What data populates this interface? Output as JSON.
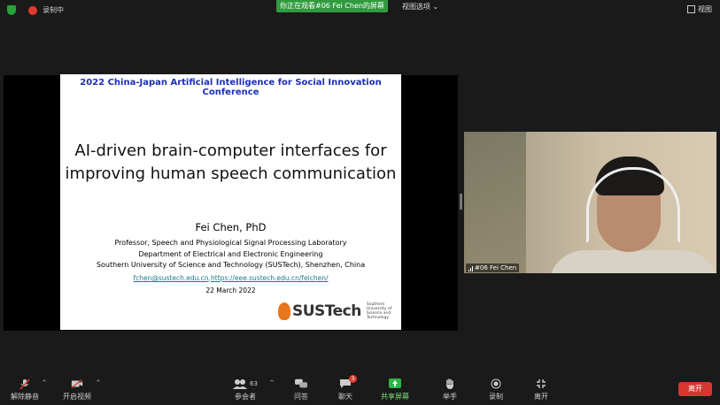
{
  "top": {
    "recording": "录制中",
    "viewing_notice": "你正在观看#06 Fei Chen的屏幕",
    "view_options": "视图选项",
    "view_button": "视图"
  },
  "slide": {
    "conference": "2022 China-Japan Artificial Intelligence for Social Innovation Conference",
    "title_line1": "AI-driven brain-computer interfaces for",
    "title_line2": "improving human speech communication",
    "author": "Fei Chen, PhD",
    "affiliations": [
      "Professor, Speech and Physiological Signal Processing Laboratory",
      "Department of Electrical and Electronic Engineering",
      "Southern University of Science and Technology (SUSTech), Shenzhen, China"
    ],
    "email": "fchen@sustech.edu.cn",
    "url": "https://eee.sustech.edu.cn/feichen/",
    "date": "22 March 2022",
    "logo_word": "SUSTech",
    "logo_sub": "Southern University of Science and Technology"
  },
  "video": {
    "label": "#06 Fei Chen"
  },
  "toolbar": {
    "unmute": "解除静音",
    "start_video": "开启视频",
    "participants": "参会者",
    "participants_count": "63",
    "qa": "问答",
    "chat": "聊天",
    "chat_badge": "3",
    "share_screen": "共享屏幕",
    "raise_hand": "举手",
    "record": "录制",
    "leave": "离开",
    "leave_button": "离开"
  }
}
